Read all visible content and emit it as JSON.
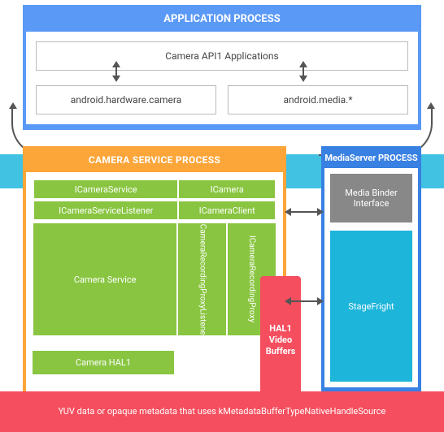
{
  "app_process": {
    "title": "APPLICATION PROCESS",
    "api_apps": "Camera API1 Applications",
    "hw_camera": "android.hardware.camera",
    "media": "android.media.*"
  },
  "camera_service_process": {
    "title": "CAMERA SERVICE PROCESS",
    "cells": {
      "icameraservice": "ICameraService",
      "icamera": "ICamera",
      "icameraservicelistener": "ICameraServiceListener",
      "icameraclient": "ICameraClient",
      "camera_service": "Camera Service",
      "irec_proxy_listener": "ICameraRecordingProxyListener",
      "irec_proxy": "ICameraRecordingProxy"
    },
    "hal1": "Camera HAL1"
  },
  "mediaserver_process": {
    "title": "MediaServer PROCESS",
    "binder": "Media Binder Interface",
    "stagefright": "StageFright"
  },
  "hal1_video": "HAL1 Video Buffers",
  "yuv_note": "YUV data or opaque metadata that uses kMetadataBufferTypeNativeHandleSource"
}
